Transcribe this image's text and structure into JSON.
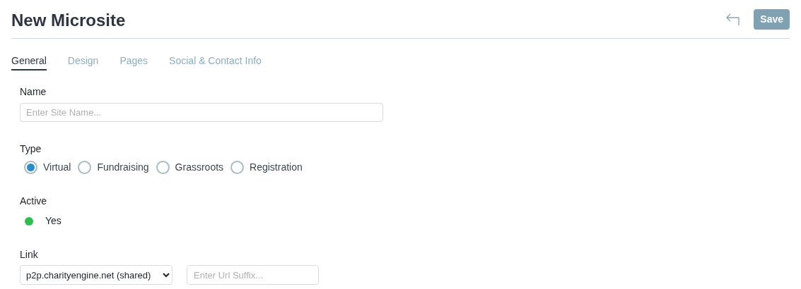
{
  "title": "New Microsite",
  "save_button": {
    "label": "Save",
    "disabled": true
  },
  "tabs": [
    {
      "label": "General",
      "selected": true
    },
    {
      "label": "Design",
      "selected": false
    },
    {
      "label": "Pages",
      "selected": false
    },
    {
      "label": "Social & Contact Info",
      "selected": false
    }
  ],
  "name": {
    "label": "Name",
    "placeholder": "Enter Site Name..."
  },
  "type": {
    "label": "Type",
    "options": [
      {
        "label": "Virtual",
        "selected": true
      },
      {
        "label": "Fundraising",
        "selected": false
      },
      {
        "label": "Grassroots",
        "selected": false
      },
      {
        "label": "Registration",
        "selected": false
      }
    ]
  },
  "active": {
    "label": "Active",
    "on": true,
    "value": "Yes"
  },
  "link": {
    "label": "Link",
    "domain": "p2p.charityengine.net (shared)",
    "suffix_placeholder": "Enter Url Suffix..."
  }
}
